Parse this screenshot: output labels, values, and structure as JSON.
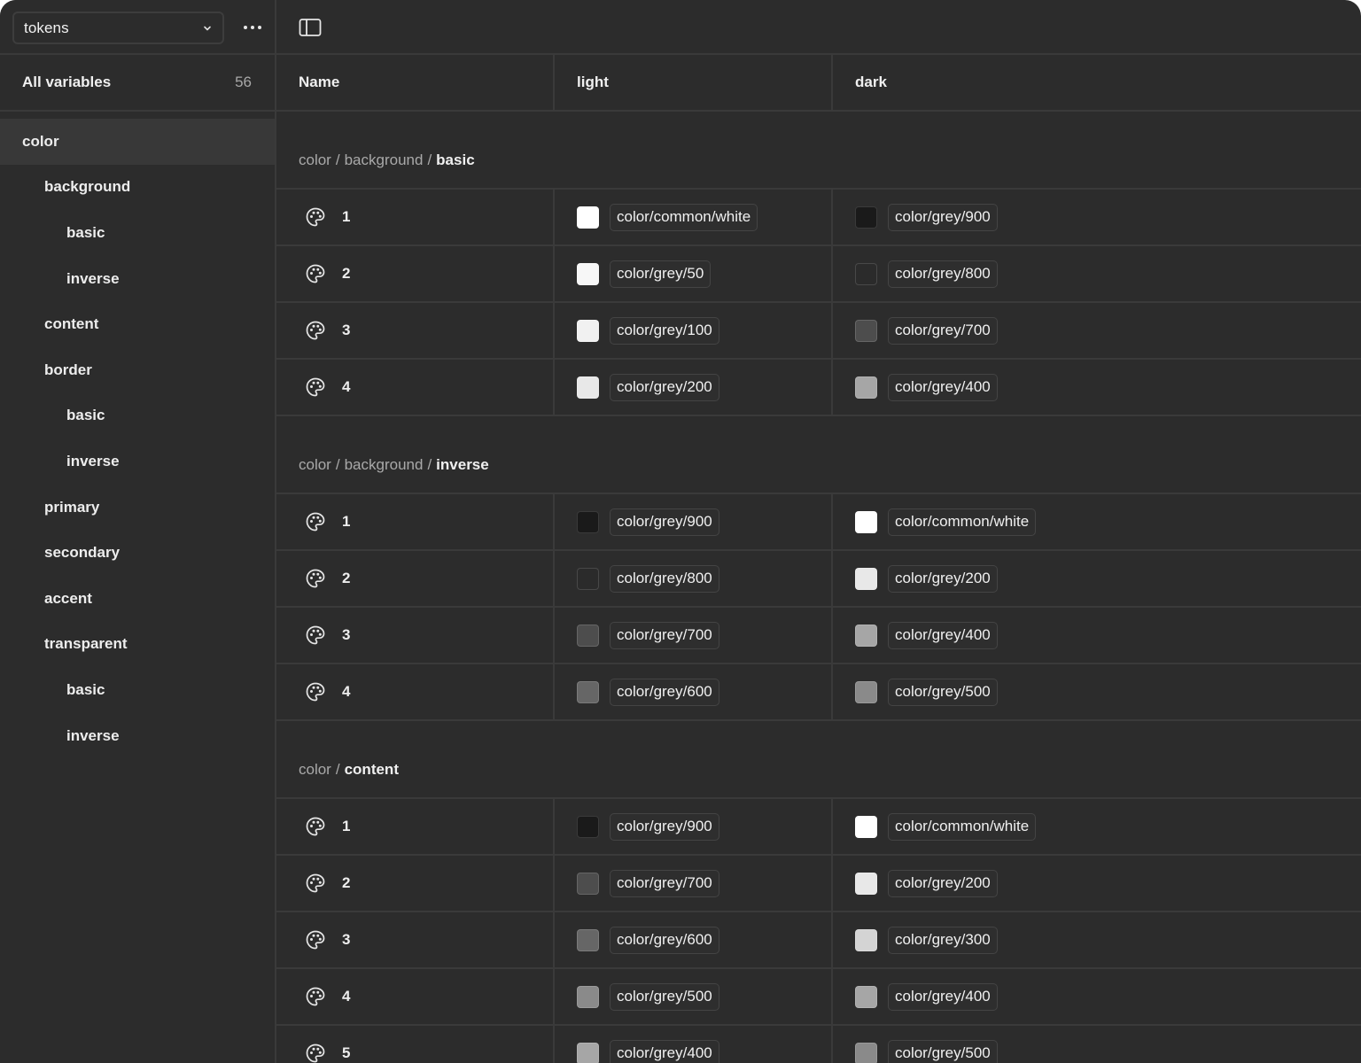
{
  "sidebar": {
    "collection": "tokens",
    "all_variables_label": "All variables",
    "all_variables_count": "56",
    "groups": [
      {
        "label": "color",
        "level": 0,
        "selected": true
      },
      {
        "label": "background",
        "level": 1
      },
      {
        "label": "basic",
        "level": 2
      },
      {
        "label": "inverse",
        "level": 2
      },
      {
        "label": "content",
        "level": 1
      },
      {
        "label": "border",
        "level": 1
      },
      {
        "label": "basic",
        "level": 2
      },
      {
        "label": "inverse",
        "level": 2
      },
      {
        "label": "primary",
        "level": 1
      },
      {
        "label": "secondary",
        "level": 1
      },
      {
        "label": "accent",
        "level": 1
      },
      {
        "label": "transparent",
        "level": 1
      },
      {
        "label": "basic",
        "level": 2
      },
      {
        "label": "inverse",
        "level": 2
      }
    ]
  },
  "table": {
    "headers": {
      "name": "Name",
      "light": "light",
      "dark": "dark"
    },
    "sections": [
      {
        "path": [
          "color",
          "background"
        ],
        "leaf": "basic",
        "rows": [
          {
            "name": "1",
            "light": {
              "alias": "color/common/white",
              "color": "#ffffff"
            },
            "dark": {
              "alias": "color/grey/900",
              "color": "#1a1a1a"
            }
          },
          {
            "name": "2",
            "light": {
              "alias": "color/grey/50",
              "color": "#f7f7f7"
            },
            "dark": {
              "alias": "color/grey/800",
              "color": "#2b2b2b"
            }
          },
          {
            "name": "3",
            "light": {
              "alias": "color/grey/100",
              "color": "#f1f1f1"
            },
            "dark": {
              "alias": "color/grey/700",
              "color": "#4d4d4d"
            }
          },
          {
            "name": "4",
            "light": {
              "alias": "color/grey/200",
              "color": "#e8e8e8"
            },
            "dark": {
              "alias": "color/grey/400",
              "color": "#a6a6a6"
            }
          }
        ]
      },
      {
        "path": [
          "color",
          "background"
        ],
        "leaf": "inverse",
        "rows": [
          {
            "name": "1",
            "light": {
              "alias": "color/grey/900",
              "color": "#1a1a1a"
            },
            "dark": {
              "alias": "color/common/white",
              "color": "#ffffff"
            }
          },
          {
            "name": "2",
            "light": {
              "alias": "color/grey/800",
              "color": "#2b2b2b"
            },
            "dark": {
              "alias": "color/grey/200",
              "color": "#e8e8e8"
            }
          },
          {
            "name": "3",
            "light": {
              "alias": "color/grey/700",
              "color": "#4d4d4d"
            },
            "dark": {
              "alias": "color/grey/400",
              "color": "#a6a6a6"
            }
          },
          {
            "name": "4",
            "light": {
              "alias": "color/grey/600",
              "color": "#666666"
            },
            "dark": {
              "alias": "color/grey/500",
              "color": "#8a8a8a"
            }
          }
        ]
      },
      {
        "path": [
          "color"
        ],
        "leaf": "content",
        "rows": [
          {
            "name": "1",
            "light": {
              "alias": "color/grey/900",
              "color": "#1a1a1a"
            },
            "dark": {
              "alias": "color/common/white",
              "color": "#ffffff"
            }
          },
          {
            "name": "2",
            "light": {
              "alias": "color/grey/700",
              "color": "#4d4d4d"
            },
            "dark": {
              "alias": "color/grey/200",
              "color": "#e8e8e8"
            }
          },
          {
            "name": "3",
            "light": {
              "alias": "color/grey/600",
              "color": "#666666"
            },
            "dark": {
              "alias": "color/grey/300",
              "color": "#d4d4d4"
            }
          },
          {
            "name": "4",
            "light": {
              "alias": "color/grey/500",
              "color": "#8a8a8a"
            },
            "dark": {
              "alias": "color/grey/400",
              "color": "#a6a6a6"
            }
          },
          {
            "name": "5",
            "light": {
              "alias": "color/grey/400",
              "color": "#a6a6a6"
            },
            "dark": {
              "alias": "color/grey/500",
              "color": "#8a8a8a"
            }
          }
        ]
      }
    ]
  }
}
